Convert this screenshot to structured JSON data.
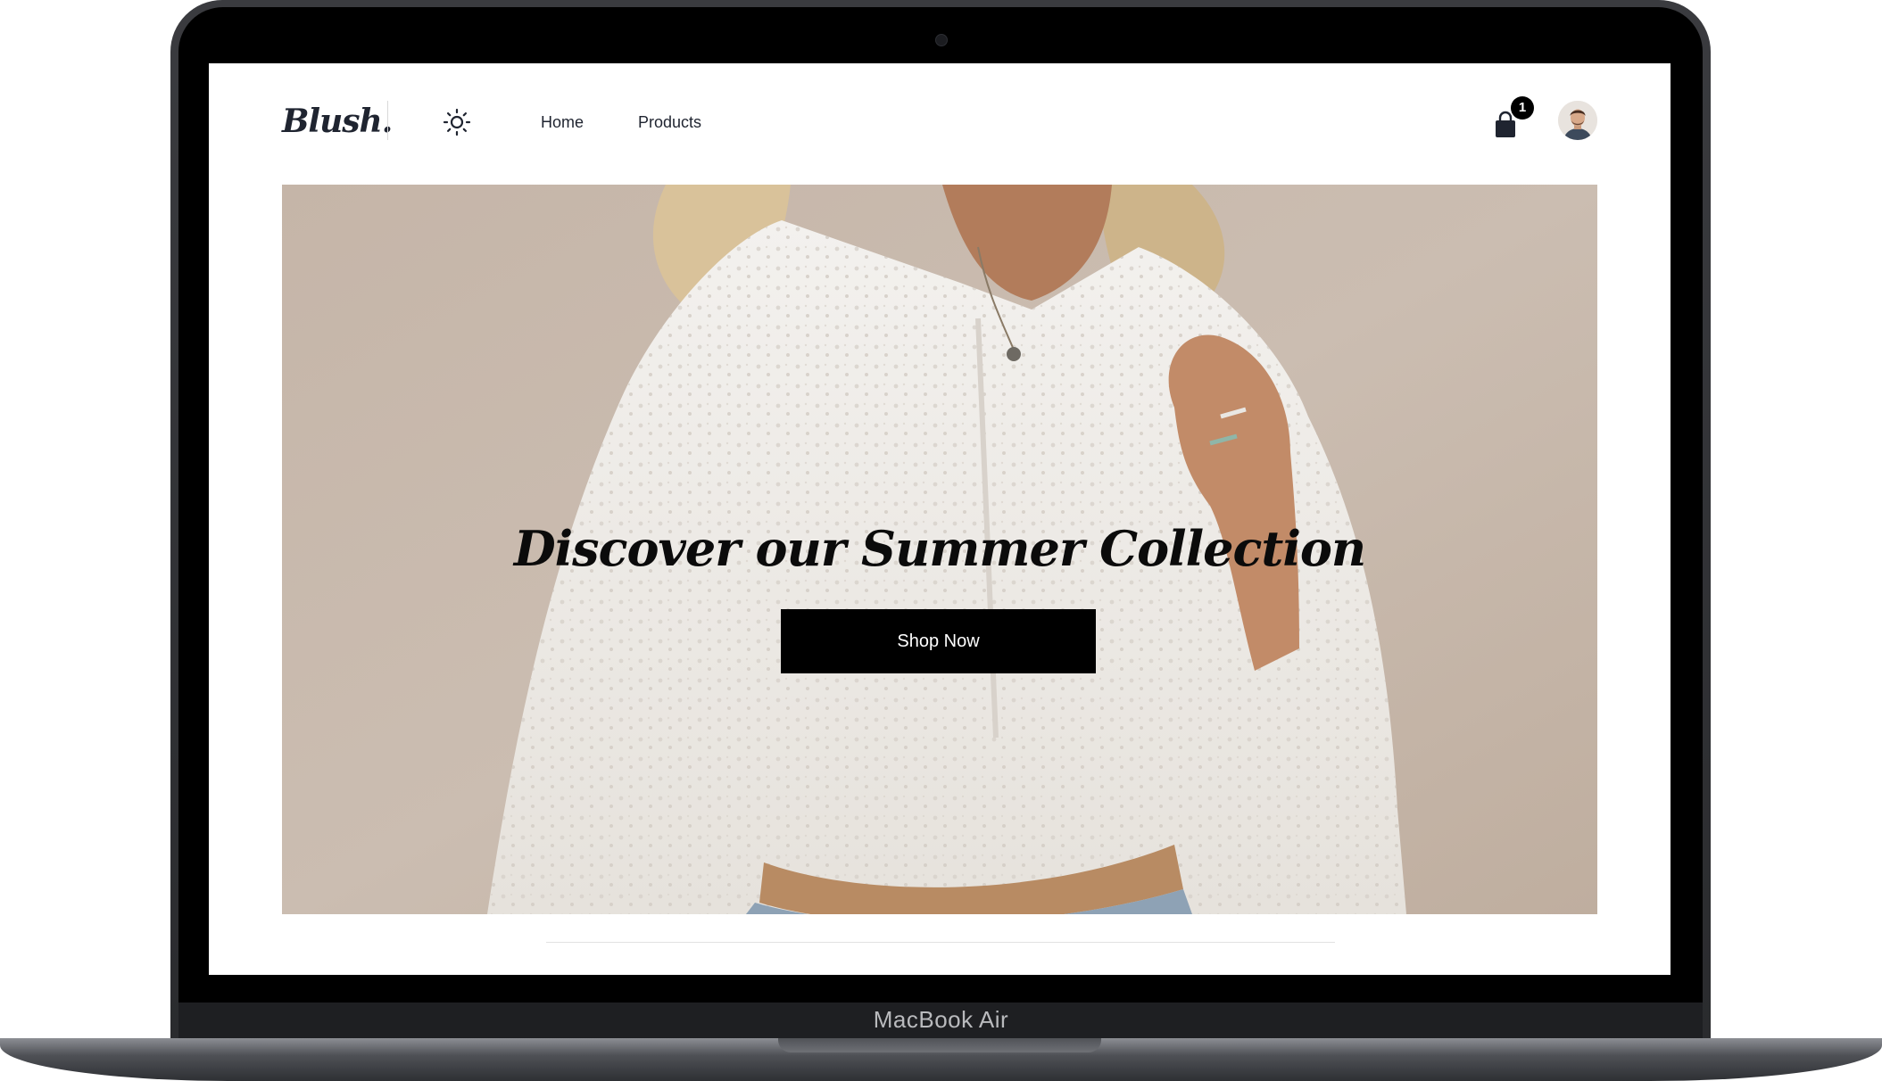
{
  "device": {
    "label": "MacBook Air"
  },
  "header": {
    "logo": "Blush.",
    "nav": [
      {
        "label": "Home"
      },
      {
        "label": "Products"
      }
    ],
    "cart_count": "1",
    "icons": {
      "theme": "sun-icon",
      "cart": "shopping-bag-icon",
      "avatar": "user-avatar"
    }
  },
  "hero": {
    "title": "Discover our Summer Collection",
    "cta_label": "Shop Now"
  },
  "colors": {
    "text_dark": "#1f2430",
    "button_bg": "#000000",
    "hero_bg": "#c7b9ad"
  }
}
